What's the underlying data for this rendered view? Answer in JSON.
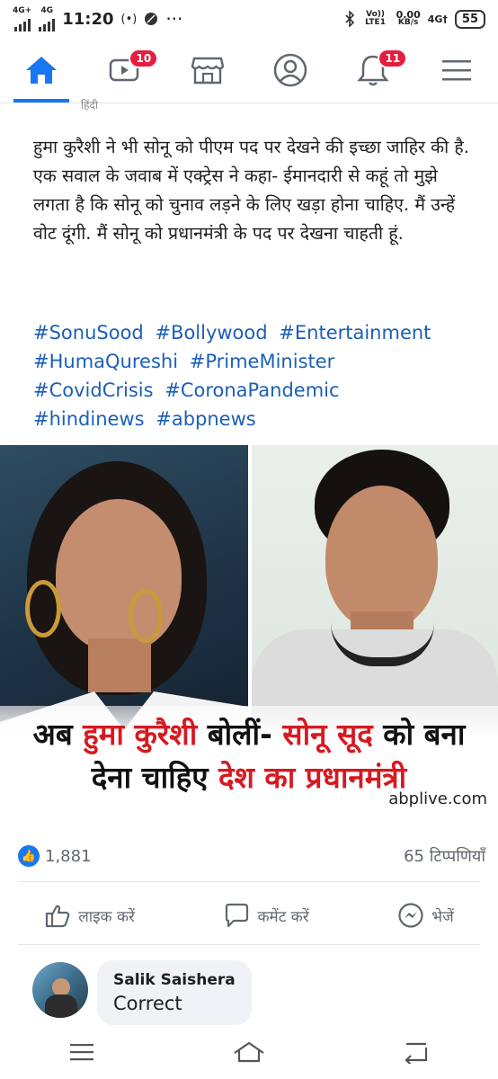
{
  "status_bar": {
    "net1": "4G+",
    "net2": "4G",
    "time": "11:20",
    "volte": "Vo)) LTE1",
    "speed": "0.00",
    "speed_unit": "KB/s",
    "net3": "4G†",
    "battery": "55"
  },
  "nav": {
    "video_badge": "10",
    "notif_badge": "11"
  },
  "post": {
    "cut_label": "हिंदी",
    "text": "हुमा कुरैशी ने भी सोनू को पीएम पद पर देखने की इच्छा जाहिर की है. एक सवाल के जवाब में एक्ट्रेस ने कहा- ईमानदारी से कहूं तो मुझे लगता है कि सोनू को चुनाव लड़ने के लिए खड़ा होना चाहिए. मैं उन्हें वोट दूंगी. मैं सोनू को प्रधानमंत्री के पद पर देखना चाहती हूं.",
    "hashtags": [
      "#SonuSood",
      "#Bollywood",
      "#Entertainment",
      "#HumaQureshi",
      "#PrimeMinister",
      "#CovidCrisis",
      "#CoronaPandemic",
      "#hindinews",
      "#abpnews"
    ]
  },
  "image": {
    "headline1_a": "अब ",
    "headline1_b": "हुमा कुरैशी",
    "headline1_c": " बोलीं- ",
    "headline1_d": "सोनू सूद",
    "headline1_e": " को बना",
    "headline2_a": "देना चाहिए ",
    "headline2_b": "देश का प्रधानमंत्री",
    "brand": "abplive.com"
  },
  "stats": {
    "likes": "1,881",
    "comments": "65 टिप्पणियाँ"
  },
  "actions": {
    "like": "लाइक करें",
    "comment": "कमेंट करें",
    "share": "भेजें"
  },
  "comment": {
    "name": "Salik Saishera",
    "text": "Correct"
  },
  "colors": {
    "accent": "#1877f2",
    "badge": "#e41e3f",
    "hashtag": "#1b5fb7",
    "headline_red": "#d71920"
  }
}
